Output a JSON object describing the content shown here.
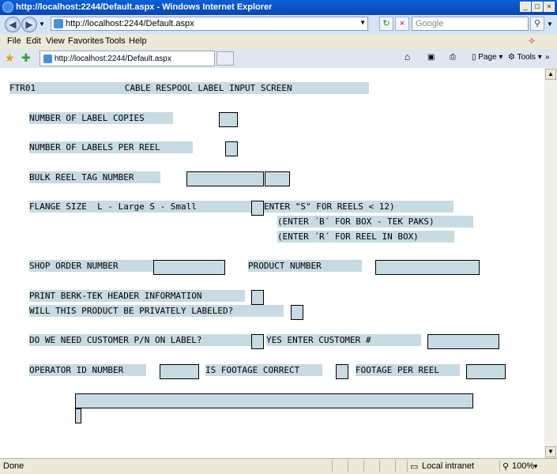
{
  "window": {
    "title": "http://localhost:2244/Default.aspx - Windows Internet Explorer"
  },
  "address_bar": {
    "url": "http://localhost:2244/Default.aspx",
    "search_placeholder": "Google"
  },
  "menu": [
    "File",
    "Edit",
    "View",
    "Favorites",
    "Tools",
    "Help"
  ],
  "tab": {
    "title": "http://localhost:2244/Default.aspx"
  },
  "toolbar": {
    "page_label": "Page",
    "tools_label": "Tools"
  },
  "screen": {
    "header": "FTR01                 CABLE RESPOOL LABEL INPUT SCREEN      ",
    "label_copies": "NUMBER OF LABEL COPIES    ",
    "labels_per_reel": "NUMBER OF LABELS PER REEL  ",
    "bulk_reel_tag": "BULK REEL TAG NUMBER   ",
    "flange_size": "FLANGE SIZE  L - Large S - Small    ",
    "flange_hint_1": "ENTER \"S\" FOR REELS < 12)    ",
    "flange_hint_2": "(ENTER ´B´ FOR BOX - TEK PAKS)",
    "flange_hint_3": "(ENTER ´R´ FOR REEL IN BOX) ",
    "shop_order": "SHOP ORDER NUMBER    ",
    "product_number": "PRODUCT NUMBER     ",
    "print_header": "PRINT BERK-TEK HEADER INFORMATION ",
    "privately_labeled": "WILL THIS PRODUCT BE PRIVATELY LABELED?  ",
    "customer_pn": "DO WE NEED CUSTOMER P/N ON LABEL?    ",
    "enter_customer": "YES ENTER CUSTOMER #    ",
    "operator_id": "OPERATOR ID NUMBER  ",
    "footage_correct": "IS FOOTAGE CORRECT ",
    "footage_per_reel": "FOOTAGE PER REEL  "
  },
  "status_bar": {
    "status": "Done",
    "zone": "Local intranet",
    "zoom": "100%"
  },
  "colors": {
    "field_bg": "#c8dae2",
    "title_bar": "#0a5fd8"
  }
}
